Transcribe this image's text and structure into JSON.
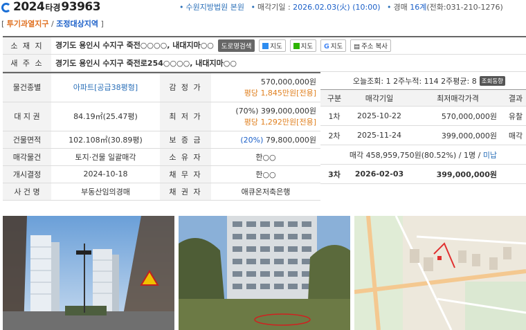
{
  "header": {
    "case_year": "2024",
    "case_type": "타경",
    "case_number": "93963",
    "court": "수원지방법원 본원",
    "sale_date_label": "매각기일 : ",
    "sale_date": "2026.02.03(火) (10:00)",
    "dept_label": "경매 ",
    "dept": "16계",
    "phone": "(전화:031-210-1276)"
  },
  "tags": {
    "open": "[ ",
    "tag1": "투기과열지구",
    "sep": " / ",
    "tag2": "조정대상지역",
    "close": " ]"
  },
  "address": {
    "location_label": "소 재 지",
    "location_value": "경기도 용인시 수지구 죽전○○○○, 내대지마○○",
    "road_label": "새 주 소",
    "road_value": "경기도 용인시 수지구 죽전로254○○○○, 내대지마○○",
    "buttons": [
      "도로명검색",
      "지도",
      "지도",
      "지도",
      "주소 복사"
    ]
  },
  "details": {
    "item_type_label": "물건종별",
    "item_type_value": "아파트[공급38평형]",
    "appraisal_label": "감 정 가",
    "appraisal_value": "570,000,000원",
    "appraisal_sub": "평당 1,845만원[전용]",
    "land_label": "대 지 권",
    "land_value": "84.19㎡(25.47평)",
    "min_price_label": "최 저 가",
    "min_price_value": "(70%) 399,000,000원",
    "min_price_sub": "평당 1,292만원[전용]",
    "building_label": "건물면적",
    "building_value": "102.108㎡(30.89평)",
    "deposit_label": "보 증 금",
    "deposit_pct": "(20%)",
    "deposit_value": " 79,800,000원",
    "sale_item_label": "매각물건",
    "sale_item_value": "토지·건물 일괄매각",
    "owner_label": "소 유 자",
    "owner_value": "한○○",
    "start_label": "개시결정",
    "start_value": "2024-10-18",
    "debtor_label": "채 무 자",
    "debtor_value": "한○○",
    "case_label": "사 건 명",
    "case_value": "부동산임의경매",
    "creditor_label": "채 권 자",
    "creditor_value": "애큐온저축은행"
  },
  "views": {
    "text": "오늘조회: 1  2주누적: 114  2주평균: 8",
    "button": "조회동향"
  },
  "history": {
    "headers": [
      "구분",
      "매각기일",
      "최저매각가격",
      "결과"
    ],
    "rows": [
      {
        "round": "1차",
        "date": "2025-10-22",
        "price": "570,000,000원",
        "result": "유찰"
      },
      {
        "round": "2차",
        "date": "2025-11-24",
        "price": "399,000,000원",
        "result": "매각"
      }
    ],
    "note_prefix": "매각 458,959,750원(80.52%) / 1명 / ",
    "note_link": "미납",
    "final": {
      "round": "3차",
      "date": "2026-02-03",
      "price": "399,000,000원"
    }
  }
}
